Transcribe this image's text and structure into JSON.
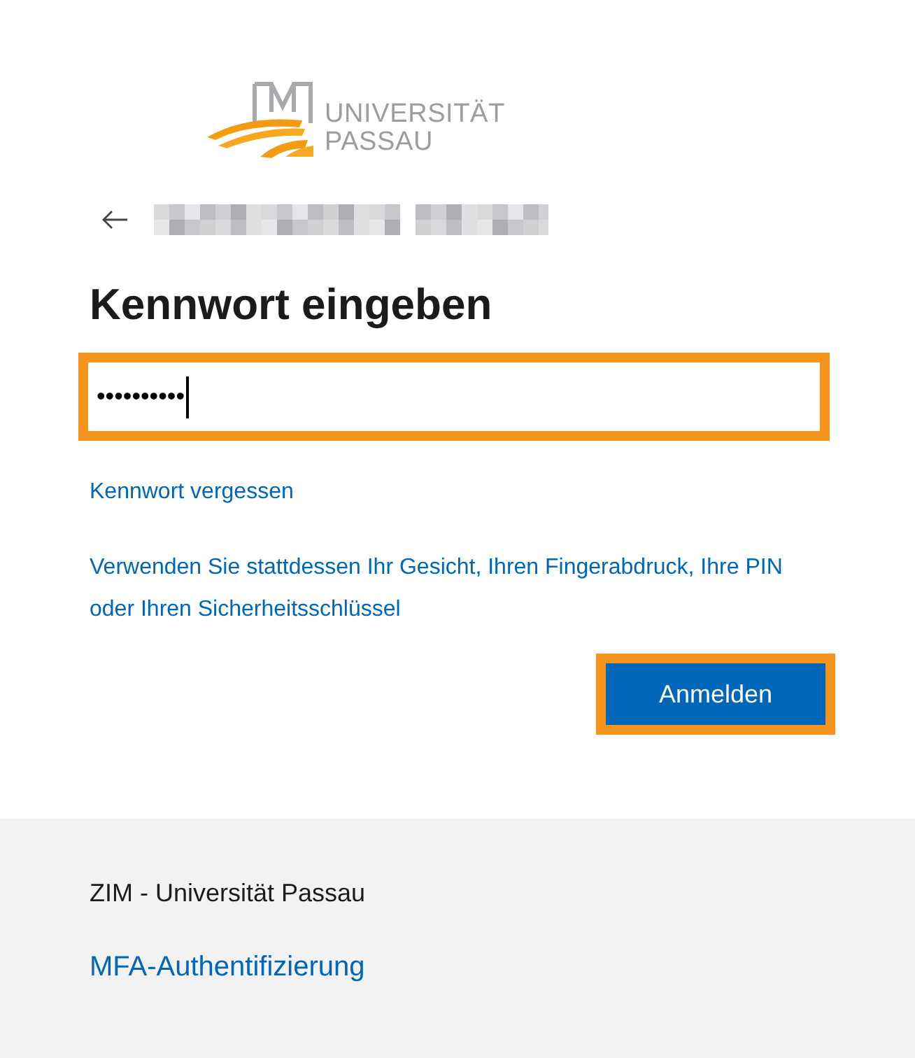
{
  "logo": {
    "line_1": "UNIVERSITÄT",
    "line_2": "PASSAU"
  },
  "heading": "Kennwort eingeben",
  "password_field": {
    "value": "••••••••••",
    "focused": true,
    "highlighted": true
  },
  "links": [
    "Kennwort vergessen",
    "Verwenden Sie stattdessen Ihr Gesicht, Ihren Fingerabdruck, Ihre PIN oder Ihren Sicherheitsschlüssel"
  ],
  "sign_in_button": {
    "label": "Anmelden",
    "highlighted": true
  },
  "footer": {
    "organization": "ZIM - Universität Passau",
    "link": "MFA-Authentifizierung"
  }
}
